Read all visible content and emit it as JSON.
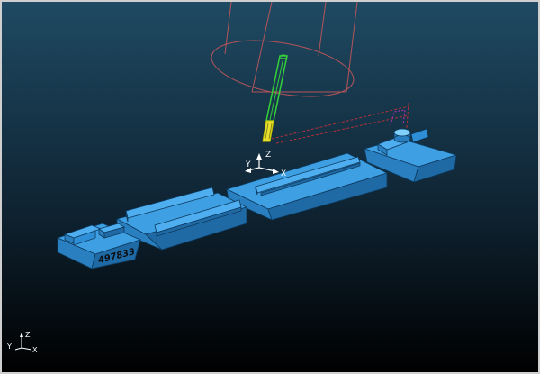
{
  "scene": {
    "part_number": "497833",
    "workpiece_color": "#2f8fd6",
    "tool_color": "#34d13a",
    "holder_wire_color": "#b4545a",
    "toolpath_color": "#b0303a"
  },
  "axes": {
    "local": {
      "x": "X",
      "y": "Y",
      "z": "Z"
    },
    "global": {
      "x": "X",
      "y": "Y",
      "z": "Z"
    }
  }
}
